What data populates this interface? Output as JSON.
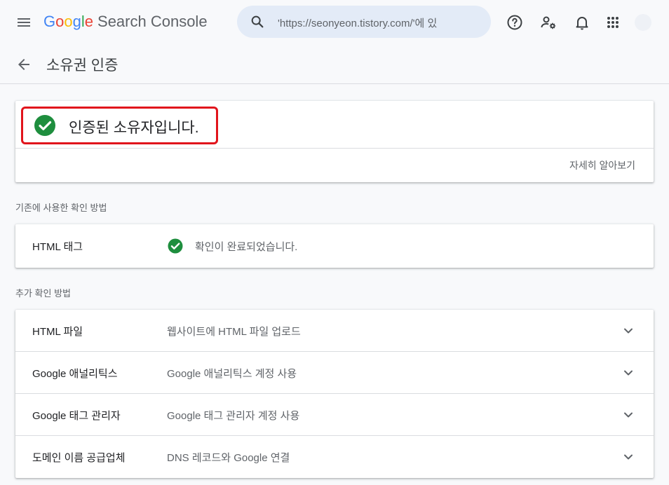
{
  "header": {
    "brand": [
      {
        "letter": "G",
        "color": "#4285F4"
      },
      {
        "letter": "o",
        "color": "#EA4335"
      },
      {
        "letter": "o",
        "color": "#FBBC05"
      },
      {
        "letter": "g",
        "color": "#4285F4"
      },
      {
        "letter": "l",
        "color": "#34A853"
      },
      {
        "letter": "e",
        "color": "#EA4335"
      }
    ],
    "product": "Search Console",
    "search_value": "'https://seonyeon.tistory.com/'에 있",
    "icons": [
      "menu-icon",
      "search-icon",
      "help-icon",
      "manage-users-icon",
      "notifications-icon",
      "apps-icon"
    ]
  },
  "title_bar": {
    "title": "소유권 인증"
  },
  "verified": {
    "message": "인증된 소유자입니다.",
    "learn_more": "자세히 알아보기",
    "check_color": "#1e8e3e",
    "highlight_color": "#e1141c"
  },
  "used_methods": {
    "label": "기존에 사용한 확인 방법",
    "rows": [
      {
        "name": "HTML 태그",
        "status": "확인이 완료되었습니다."
      }
    ]
  },
  "additional_methods": {
    "label": "추가 확인 방법",
    "rows": [
      {
        "name": "HTML 파일",
        "desc": "웹사이트에 HTML 파일 업로드"
      },
      {
        "name": "Google 애널리틱스",
        "desc": "Google 애널리틱스 계정 사용"
      },
      {
        "name": "Google 태그 관리자",
        "desc": "Google 태그 관리자 계정 사용"
      },
      {
        "name": "도메인 이름 공급업체",
        "desc": "DNS 레코드와 Google 연결"
      }
    ]
  }
}
